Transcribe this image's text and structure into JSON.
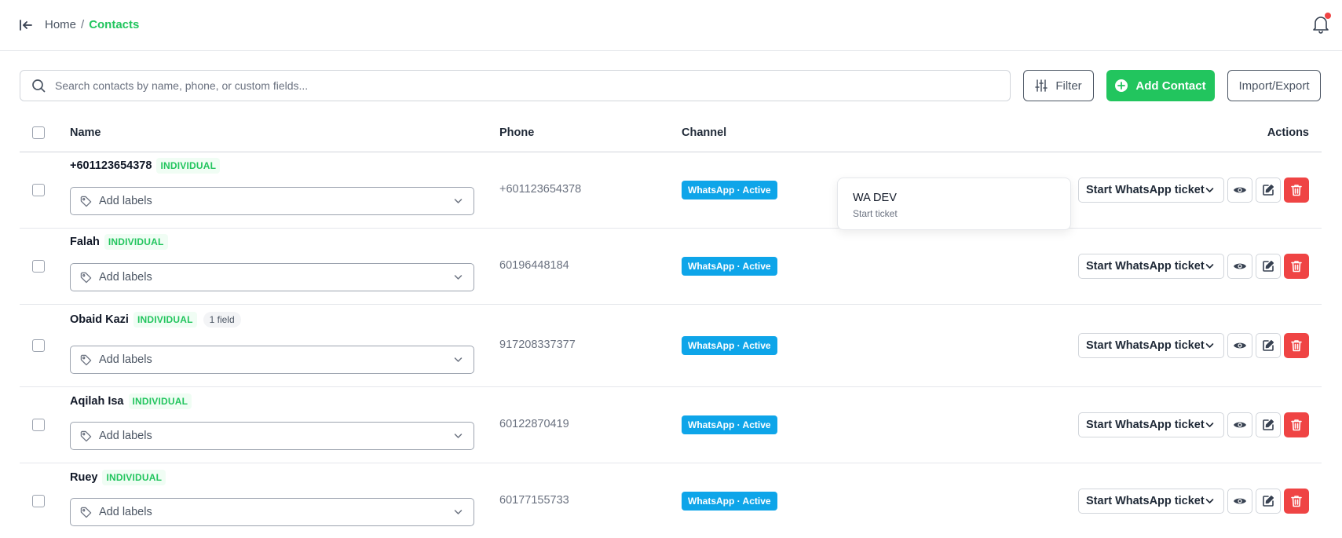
{
  "breadcrumb": {
    "home": "Home",
    "separator": "/",
    "current": "Contacts"
  },
  "search": {
    "placeholder": "Search contacts by name, phone, or custom fields..."
  },
  "toolbar": {
    "filter_label": "Filter",
    "add_label": "Add Contact",
    "import_label": "Import/Export"
  },
  "table": {
    "headers": {
      "name": "Name",
      "phone": "Phone",
      "channel": "Channel",
      "actions": "Actions"
    },
    "labels_placeholder": "Add labels",
    "ticket_label": "Start WhatsApp ticket",
    "rows": [
      {
        "name": "+601123654378",
        "type": "INDIVIDUAL",
        "fields": "",
        "phone": "+601123654378",
        "channel": "WhatsApp · Active"
      },
      {
        "name": "Falah",
        "type": "INDIVIDUAL",
        "fields": "",
        "phone": "60196448184",
        "channel": "WhatsApp · Active"
      },
      {
        "name": "Obaid Kazi",
        "type": "INDIVIDUAL",
        "fields": "1 field",
        "phone": "917208337377",
        "channel": "WhatsApp · Active"
      },
      {
        "name": "Aqilah Isa",
        "type": "INDIVIDUAL",
        "fields": "",
        "phone": "60122870419",
        "channel": "WhatsApp · Active"
      },
      {
        "name": "Ruey",
        "type": "INDIVIDUAL",
        "fields": "",
        "phone": "60177155733",
        "channel": "WhatsApp · Active"
      }
    ]
  },
  "popover": {
    "title": "WA DEV",
    "subtitle": "Start ticket"
  },
  "colors": {
    "brand": "#22c55e",
    "channel": "#0ea5e9",
    "danger": "#ef4444"
  },
  "icons": [
    "collapse-sidebar-icon",
    "bell-icon",
    "search-icon",
    "sliders-icon",
    "plus-circle-icon",
    "tag-icon",
    "chevron-down-icon",
    "eye-icon",
    "edit-icon",
    "trash-icon"
  ]
}
